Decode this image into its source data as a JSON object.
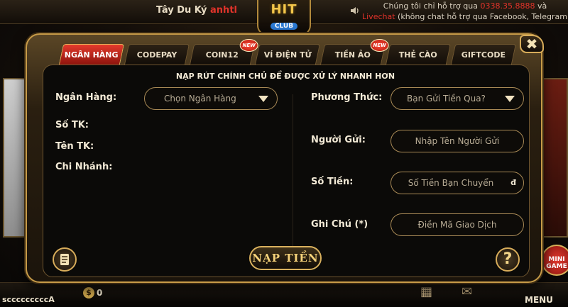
{
  "topbar": {
    "game_name": "Tây Du Ký",
    "player_nick": "anhtl",
    "logo_text": "HIT",
    "logo_sub": "CLUB",
    "ticker_line1_pre": "Chúng tôi chỉ hỗ trợ qua ",
    "ticker_phone": "0338.35.8888",
    "ticker_line1_post": " và",
    "ticker_live": "Livechat",
    "ticker_line2": " (không chat hỗ trợ qua Facebook, Telegram..."
  },
  "tabs": [
    {
      "label": "NGÂN HÀNG",
      "active": true,
      "new": false
    },
    {
      "label": "CODEPAY",
      "active": false,
      "new": false
    },
    {
      "label": "COIN12",
      "active": false,
      "new": true
    },
    {
      "label": "VÍ ĐIỆN TỬ",
      "active": false,
      "new": false
    },
    {
      "label": "TIỀN ẢO",
      "active": false,
      "new": true
    },
    {
      "label": "THẺ CÀO",
      "active": false,
      "new": false
    },
    {
      "label": "GIFTCODE",
      "active": false,
      "new": false
    }
  ],
  "new_badge": "NEW",
  "close_label": "✖",
  "headline": "NẠP RÚT CHÍNH CHỦ ĐỂ ĐƯỢC XỬ LÝ NHANH HƠN",
  "left": {
    "bank_label": "Ngân Hàng:",
    "bank_select": "Chọn Ngân Hàng",
    "account_no_label": "Số TK:",
    "account_name_label": "Tên TK:",
    "branch_label": "Chi Nhánh:"
  },
  "right": {
    "method_label": "Phương Thức:",
    "method_select": "Bạn Gửi Tiền Qua?",
    "sender_label": "Người Gửi:",
    "sender_placeholder": "Nhập Tên Người Gửi",
    "amount_label": "Số Tiền:",
    "amount_placeholder": "Số Tiền Bạn Chuyển",
    "amount_unit": "đ",
    "note_label": "Ghi Chú (*)",
    "note_placeholder": "Điền Mã Giao Dịch"
  },
  "deposit_button": "NẠP TIỀN",
  "help_button": "?",
  "bottombar": {
    "balance": "0",
    "username": "scccccccccA",
    "menu": "MENU",
    "mini_game": "MINI GAME"
  },
  "icons": [
    "speaker-icon",
    "notes-icon",
    "help-icon",
    "coin-icon",
    "mail-icon",
    "grid-icon",
    "close-icon"
  ]
}
